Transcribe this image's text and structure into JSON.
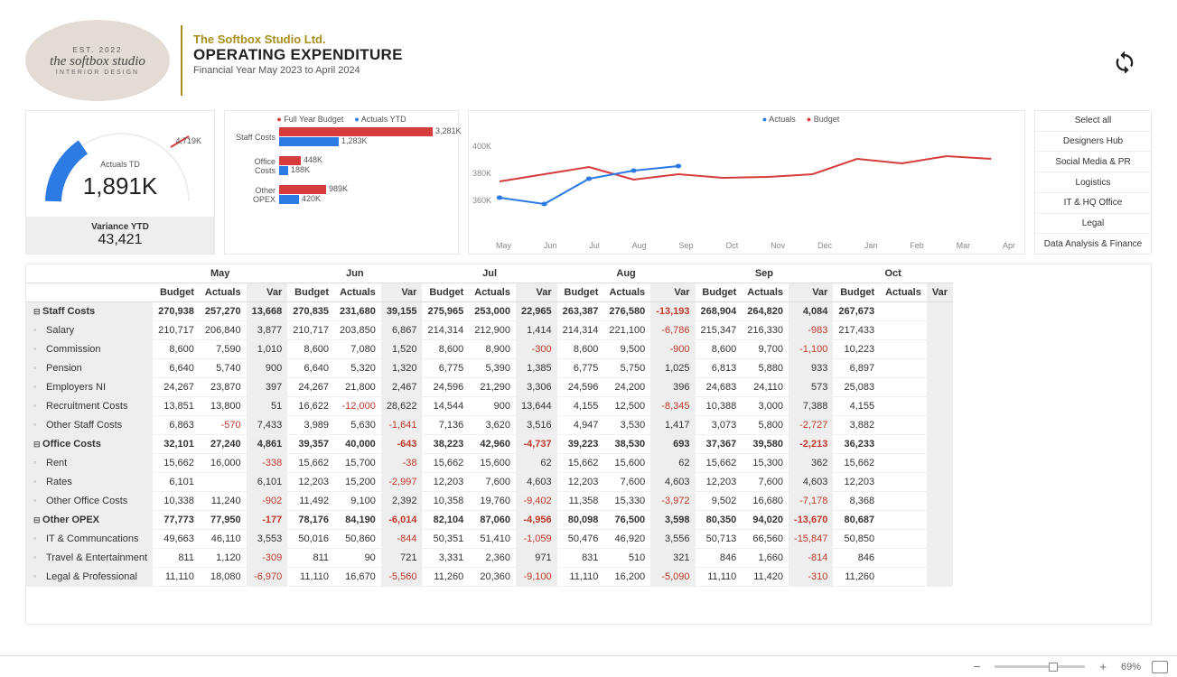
{
  "header": {
    "logo_top": "EST. 2022",
    "logo_main": "the softbox studio",
    "logo_bottom": "INTERIOR DESIGN",
    "company": "The Softbox Studio Ltd.",
    "title": "OPERATING EXPENDITURE",
    "subtitle": "Financial Year May 2023 to April 2024"
  },
  "gauge": {
    "label": "Actuals TD",
    "value": "1,891K",
    "max": "4,719K",
    "variance_label": "Variance YTD",
    "variance_value": "43,421"
  },
  "bar_chart": {
    "legend_budget": "Full Year Budget",
    "legend_actuals": "Actuals YTD",
    "rows": [
      {
        "label": "Staff Costs",
        "budget": "3,281K",
        "budget_w": 170,
        "actuals": "1,283K",
        "actuals_w": 66
      },
      {
        "label": "Office Costs",
        "budget": "448K",
        "budget_w": 24,
        "actuals": "188K",
        "actuals_w": 10
      },
      {
        "label": "Other OPEX",
        "budget": "989K",
        "budget_w": 52,
        "actuals": "420K",
        "actuals_w": 22
      }
    ]
  },
  "line_chart": {
    "legend_actuals": "Actuals",
    "legend_budget": "Budget",
    "y_labels": [
      "400K",
      "380K",
      "360K"
    ],
    "x_labels": [
      "May",
      "Jun",
      "Jul",
      "Aug",
      "Sep",
      "Oct",
      "Nov",
      "Dec",
      "Jan",
      "Feb",
      "Mar",
      "Apr"
    ]
  },
  "slicer": [
    "Select all",
    "Designers Hub",
    "Social Media & PR",
    "Logistics",
    "IT & HQ Office",
    "Legal",
    "Data Analysis & Finance"
  ],
  "months": [
    "May",
    "Jun",
    "Jul",
    "Aug",
    "Sep",
    "Oct"
  ],
  "cols": [
    "Budget",
    "Actuals",
    "Var"
  ],
  "table": [
    {
      "cat": true,
      "name": "Staff Costs",
      "v": [
        "270,938",
        "257,270",
        "13,668",
        "270,835",
        "231,680",
        "39,155",
        "275,965",
        "253,000",
        "22,965",
        "263,387",
        "276,580",
        "-13,193",
        "268,904",
        "264,820",
        "4,084",
        "267,673",
        "",
        ""
      ]
    },
    {
      "name": "Salary",
      "v": [
        "210,717",
        "206,840",
        "3,877",
        "210,717",
        "203,850",
        "6,867",
        "214,314",
        "212,900",
        "1,414",
        "214,314",
        "221,100",
        "-6,786",
        "215,347",
        "216,330",
        "-983",
        "217,433",
        "",
        ""
      ]
    },
    {
      "name": "Commission",
      "v": [
        "8,600",
        "7,590",
        "1,010",
        "8,600",
        "7,080",
        "1,520",
        "8,600",
        "8,900",
        "-300",
        "8,600",
        "9,500",
        "-900",
        "8,600",
        "9,700",
        "-1,100",
        "10,223",
        "",
        ""
      ]
    },
    {
      "name": "Pension",
      "v": [
        "6,640",
        "5,740",
        "900",
        "6,640",
        "5,320",
        "1,320",
        "6,775",
        "5,390",
        "1,385",
        "6,775",
        "5,750",
        "1,025",
        "6,813",
        "5,880",
        "933",
        "6,897",
        "",
        ""
      ]
    },
    {
      "name": "Employers NI",
      "v": [
        "24,267",
        "23,870",
        "397",
        "24,267",
        "21,800",
        "2,467",
        "24,596",
        "21,290",
        "3,306",
        "24,596",
        "24,200",
        "396",
        "24,683",
        "24,110",
        "573",
        "25,083",
        "",
        ""
      ]
    },
    {
      "name": "Recruitment Costs",
      "v": [
        "13,851",
        "13,800",
        "51",
        "16,622",
        "-12,000",
        "28,622",
        "14,544",
        "900",
        "13,644",
        "4,155",
        "12,500",
        "-8,345",
        "10,388",
        "3,000",
        "7,388",
        "4,155",
        "",
        ""
      ]
    },
    {
      "name": "Other Staff Costs",
      "v": [
        "6,863",
        "-570",
        "7,433",
        "3,989",
        "5,630",
        "-1,641",
        "7,136",
        "3,620",
        "3,516",
        "4,947",
        "3,530",
        "1,417",
        "3,073",
        "5,800",
        "-2,727",
        "3,882",
        "",
        ""
      ]
    },
    {
      "cat": true,
      "name": "Office Costs",
      "v": [
        "32,101",
        "27,240",
        "4,861",
        "39,357",
        "40,000",
        "-643",
        "38,223",
        "42,960",
        "-4,737",
        "39,223",
        "38,530",
        "693",
        "37,367",
        "39,580",
        "-2,213",
        "36,233",
        "",
        ""
      ]
    },
    {
      "name": "Rent",
      "v": [
        "15,662",
        "16,000",
        "-338",
        "15,662",
        "15,700",
        "-38",
        "15,662",
        "15,600",
        "62",
        "15,662",
        "15,600",
        "62",
        "15,662",
        "15,300",
        "362",
        "15,662",
        "",
        ""
      ]
    },
    {
      "name": "Rates",
      "v": [
        "6,101",
        "",
        "6,101",
        "12,203",
        "15,200",
        "-2,997",
        "12,203",
        "7,600",
        "4,603",
        "12,203",
        "7,600",
        "4,603",
        "12,203",
        "7,600",
        "4,603",
        "12,203",
        "",
        ""
      ]
    },
    {
      "name": "Other Office Costs",
      "v": [
        "10,338",
        "11,240",
        "-902",
        "11,492",
        "9,100",
        "2,392",
        "10,358",
        "19,760",
        "-9,402",
        "11,358",
        "15,330",
        "-3,972",
        "9,502",
        "16,680",
        "-7,178",
        "8,368",
        "",
        ""
      ]
    },
    {
      "cat": true,
      "name": "Other OPEX",
      "v": [
        "77,773",
        "77,950",
        "-177",
        "78,176",
        "84,190",
        "-6,014",
        "82,104",
        "87,060",
        "-4,956",
        "80,098",
        "76,500",
        "3,598",
        "80,350",
        "94,020",
        "-13,670",
        "80,687",
        "",
        ""
      ]
    },
    {
      "name": "IT & Communcations",
      "v": [
        "49,663",
        "46,110",
        "3,553",
        "50,016",
        "50,860",
        "-844",
        "50,351",
        "51,410",
        "-1,059",
        "50,476",
        "46,920",
        "3,556",
        "50,713",
        "66,560",
        "-15,847",
        "50,850",
        "",
        ""
      ]
    },
    {
      "name": "Travel & Entertainment",
      "v": [
        "811",
        "1,120",
        "-309",
        "811",
        "90",
        "721",
        "3,331",
        "2,360",
        "971",
        "831",
        "510",
        "321",
        "846",
        "1,660",
        "-814",
        "846",
        "",
        ""
      ]
    },
    {
      "name": "Legal & Professional",
      "v": [
        "11,110",
        "18,080",
        "-6,970",
        "11,110",
        "16,670",
        "-5,560",
        "11,260",
        "20,360",
        "-9,100",
        "11,110",
        "16,200",
        "-5,090",
        "11,110",
        "11,420",
        "-310",
        "11,260",
        "",
        ""
      ]
    }
  ],
  "statusbar": {
    "zoom": "69%"
  },
  "chart_data": [
    {
      "type": "bar",
      "title": "Actuals TD gauge",
      "value": 1891,
      "max": 4719,
      "units": "K",
      "variance_ytd": 43421
    },
    {
      "type": "bar",
      "orientation": "horizontal",
      "categories": [
        "Staff Costs",
        "Office Costs",
        "Other OPEX"
      ],
      "series": [
        {
          "name": "Full Year Budget",
          "values": [
            3281,
            448,
            989
          ]
        },
        {
          "name": "Actuals YTD",
          "values": [
            1283,
            188,
            420
          ]
        }
      ],
      "units": "K"
    },
    {
      "type": "line",
      "x": [
        "May",
        "Jun",
        "Jul",
        "Aug",
        "Sep",
        "Oct",
        "Nov",
        "Dec",
        "Jan",
        "Feb",
        "Mar",
        "Apr"
      ],
      "series": [
        {
          "name": "Actuals",
          "values": [
            362,
            356,
            383,
            392,
            397,
            null,
            null,
            null,
            null,
            null,
            null,
            null
          ]
        },
        {
          "name": "Budget",
          "values": [
            380,
            388,
            396,
            382,
            388,
            384,
            385,
            388,
            405,
            400,
            408,
            405
          ]
        }
      ],
      "ylim": [
        350,
        410
      ],
      "ylabel": "",
      "xlabel": "",
      "units": "K"
    }
  ]
}
